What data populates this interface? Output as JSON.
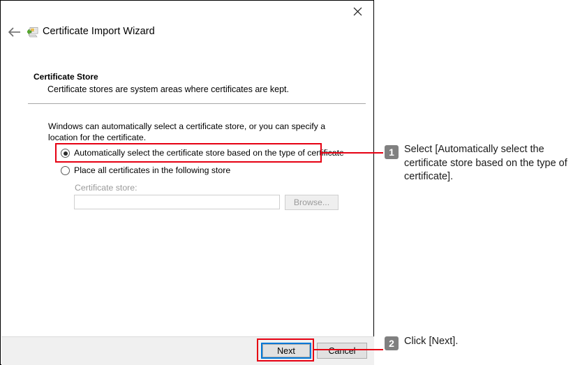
{
  "window": {
    "title": "Certificate Import Wizard",
    "icon": "certificate-import-icon",
    "back_icon": "back-arrow-icon",
    "close_icon": "close-icon"
  },
  "page": {
    "heading": "Certificate Store",
    "subheading": "Certificate stores are system areas where certificates are kept.",
    "intro": "Windows can automatically select a certificate store, or you can specify a location for the certificate."
  },
  "options": {
    "auto": {
      "label": "Automatically select the certificate store based on the type of certificate",
      "selected": true
    },
    "place": {
      "label": "Place all certificates in the following store",
      "selected": false
    }
  },
  "certificate_store": {
    "label": "Certificate store:",
    "value": "",
    "placeholder": "",
    "browse_label": "Browse...",
    "disabled": true
  },
  "footer": {
    "next_label": "Next",
    "cancel_label": "Cancel"
  },
  "annotations": {
    "accent_color": "#e60012",
    "badge_color": "#808080",
    "focus_color": "#0078d7",
    "steps": [
      {
        "number": "1",
        "text": "Select [Automatically select the certificate store based on the type of certificate]."
      },
      {
        "number": "2",
        "text": "Click [Next]."
      }
    ]
  }
}
